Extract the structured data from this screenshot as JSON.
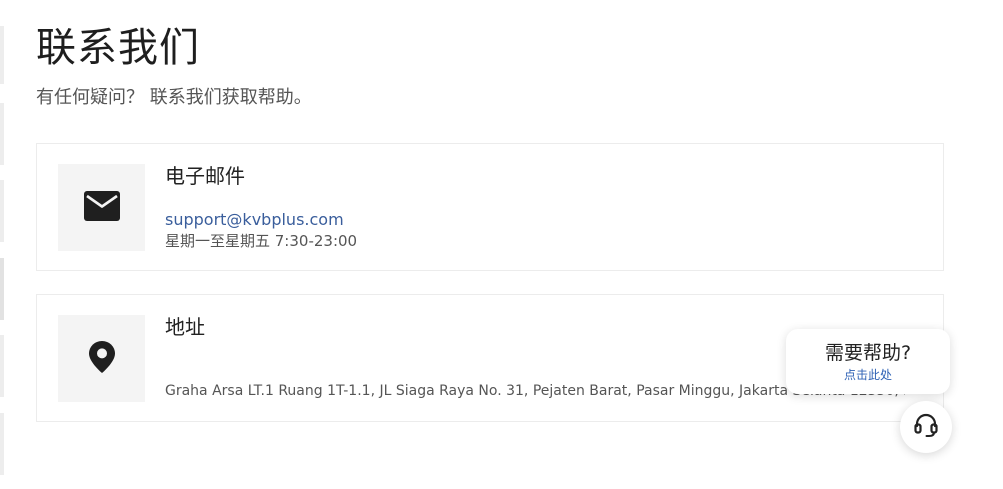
{
  "header": {
    "title": "联系我们",
    "subtitle": "有任何疑问？ 联系我们获取帮助。"
  },
  "email_card": {
    "icon": "envelope-icon",
    "heading": "电子邮件",
    "email": "support@kvbplus.com",
    "hours": "星期一至星期五 7:30-23:00"
  },
  "address_card": {
    "icon": "map-pin-icon",
    "heading": "地址",
    "address": "Graha Arsa LT.1 Ruang 1T-1.1, JL Siaga Raya No. 31, Pejaten Barat, Pasar Minggu, Jakarta Selanta 12350, Indonesia"
  },
  "help_widget": {
    "title": "需要帮助?",
    "link_label": "点击此处",
    "icon": "headset-icon"
  },
  "colors": {
    "link": "#3a5e9c",
    "help_link": "#2f62b5",
    "icon_bg": "#f4f4f4",
    "card_border": "#ececec"
  }
}
